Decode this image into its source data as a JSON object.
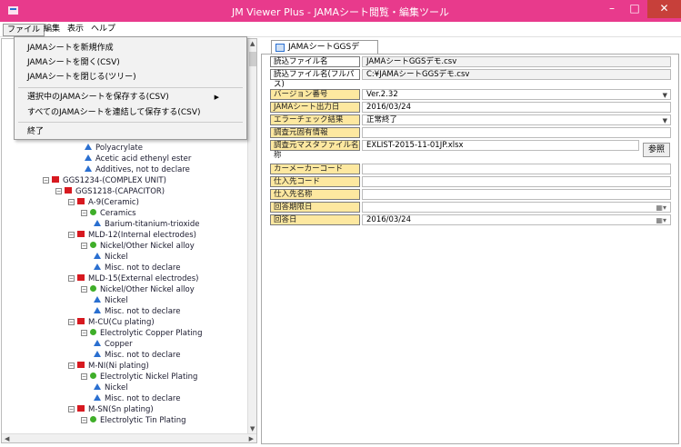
{
  "window": {
    "title": "JM Viewer Plus - JAMAシート閲覧・編集ツール",
    "minimize": "–",
    "maximize": "□",
    "close": "✕"
  },
  "menu": {
    "file": "ファイル",
    "edit": "編集",
    "view": "表示",
    "help": "ヘルプ"
  },
  "file_menu": {
    "items": [
      "JAMAシートを新規作成",
      "JAMAシートを開く(CSV)",
      "JAMAシートを閉じる(ツリー)",
      "選択中のJAMAシートを保存する(CSV)",
      "すべてのJAMAシートを連結して保存する(CSV)",
      "終了"
    ]
  },
  "tree": {
    "rows": [
      {
        "text": "Polyacrylate",
        "icon": "blue"
      },
      {
        "text": "Acetic acid ethenyl ester",
        "icon": "blue"
      },
      {
        "text": "Additives, not to declare",
        "icon": "blue"
      },
      {
        "text": "GGS1234-(COMPLEX UNIT)",
        "icon": "red",
        "exp": "−"
      },
      {
        "text": "GGS1218-(CAPACITOR)",
        "icon": "red",
        "exp": "−"
      },
      {
        "text": "A-9(Ceramic)",
        "icon": "red",
        "exp": "−"
      },
      {
        "text": "Ceramics",
        "icon": "green",
        "exp": "−"
      },
      {
        "text": "Barium-titanium-trioxide",
        "icon": "blue"
      },
      {
        "text": "MLD-12(Internal electrodes)",
        "icon": "red",
        "exp": "−"
      },
      {
        "text": "Nickel/Other Nickel alloy",
        "icon": "green",
        "exp": "−"
      },
      {
        "text": "Nickel",
        "icon": "blue"
      },
      {
        "text": "Misc. not to declare",
        "icon": "blue"
      },
      {
        "text": "MLD-15(External electrodes)",
        "icon": "red",
        "exp": "−"
      },
      {
        "text": "Nickel/Other Nickel alloy",
        "icon": "green",
        "exp": "−"
      },
      {
        "text": "Nickel",
        "icon": "blue"
      },
      {
        "text": "Misc. not to declare",
        "icon": "blue"
      },
      {
        "text": "M-CU(Cu plating)",
        "icon": "red",
        "exp": "−"
      },
      {
        "text": "Electrolytic Copper Plating",
        "icon": "green",
        "exp": "−"
      },
      {
        "text": "Copper",
        "icon": "blue"
      },
      {
        "text": "Misc. not to declare",
        "icon": "blue"
      },
      {
        "text": "M-NI(Ni plating)",
        "icon": "red",
        "exp": "−"
      },
      {
        "text": "Electrolytic Nickel Plating",
        "icon": "green",
        "exp": "−"
      },
      {
        "text": "Nickel",
        "icon": "blue"
      },
      {
        "text": "Misc. not to declare",
        "icon": "blue"
      },
      {
        "text": "M-SN(Sn plating)",
        "icon": "red",
        "exp": "−"
      },
      {
        "text": "Electrolytic Tin Plating",
        "icon": "green",
        "exp": "−"
      }
    ]
  },
  "tab": {
    "label": "JAMAシートGGSデモ.csv"
  },
  "fields": {
    "file_name_label": "読込ファイル名",
    "file_name_value": "JAMAシートGGSデモ.csv",
    "file_path_label": "読込ファイル名(フルパス)",
    "file_path_value": "C:¥JAMAシートGGSデモ.csv",
    "version_label": "バージョン番号",
    "version_value": "Ver.2.32",
    "output_date_label": "JAMAシート出力日",
    "output_date_value": "2016/03/24",
    "error_check_label": "エラーチェック結果",
    "error_check_value": "正常終了",
    "survey_source_label": "調査元固有情報",
    "survey_source_value": "",
    "master_file_label": "調査元マスタファイル名称",
    "master_file_value": "EXLIST-2015-11-01JP.xlsx",
    "ref_button": "参照",
    "maker_code_label": "カーメーカーコード",
    "maker_code_value": "",
    "supplier_code_label": "仕入先コード",
    "supplier_code_value": "",
    "supplier_name_label": "仕入先名称",
    "supplier_name_value": "",
    "due_date_label": "回答期限日",
    "due_date_value": "",
    "answer_date_label": "回答日",
    "answer_date_value": "2016/03/24"
  },
  "colors": {
    "titlebar": "#e83a8c",
    "close": "#c7403a",
    "highlight_label": "#fde8a0"
  }
}
